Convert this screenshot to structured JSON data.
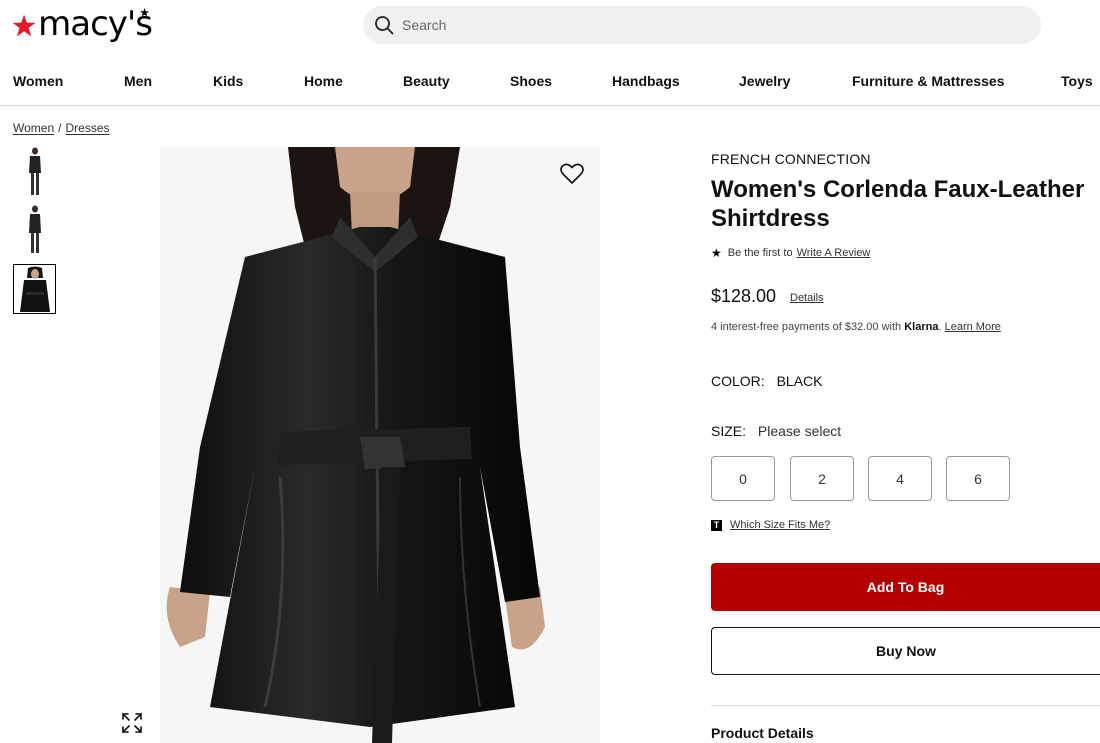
{
  "header": {
    "logo_text": "macy's",
    "search_placeholder": "Search"
  },
  "nav": {
    "items": [
      "Women",
      "Men",
      "Kids",
      "Home",
      "Beauty",
      "Shoes",
      "Handbags",
      "Jewelry",
      "Furniture & Mattresses",
      "Toys"
    ]
  },
  "breadcrumb": {
    "items": [
      "Women",
      "Dresses"
    ],
    "separator": "/"
  },
  "thumbnails": {
    "count": 3,
    "selected_index": 2
  },
  "product": {
    "brand": "FRENCH CONNECTION",
    "title": "Women's Corlenda Faux-Leather Shirtdress",
    "review_prefix": "Be the first to",
    "review_link": "Write A Review",
    "price": "$128.00",
    "price_details_link": "Details",
    "klarna_text": "4 interest-free payments of $32.00 with",
    "klarna_brand": "Klarna",
    "klarna_link": "Learn More",
    "color_label": "COLOR:",
    "color_value": "BLACK",
    "size_label": "SIZE:",
    "size_value": "Please select",
    "sizes": [
      "0",
      "2",
      "4",
      "6"
    ],
    "fit_badge": "T",
    "fit_link": "Which Size Fits Me?",
    "add_to_bag": "Add To Bag",
    "buy_now": "Buy Now",
    "product_details": "Product Details"
  },
  "colors": {
    "brand_red": "#e21a2c",
    "button_red": "#b30000"
  },
  "icons": [
    "star-logo-icon",
    "search-icon",
    "heart-icon",
    "expand-icon",
    "star-icon"
  ]
}
